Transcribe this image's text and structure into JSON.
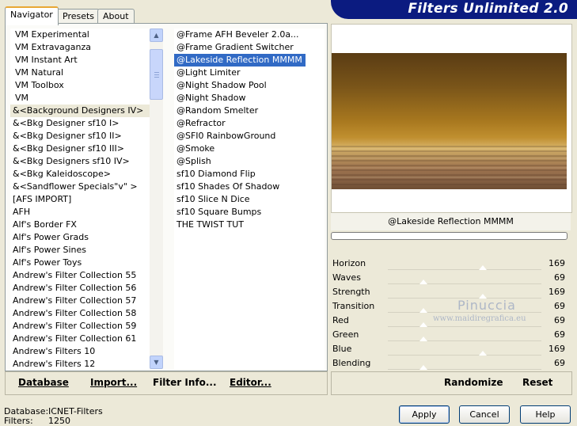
{
  "header": {
    "title": "Filters Unlimited 2.0"
  },
  "tabs": [
    {
      "label": "Navigator",
      "active": true
    },
    {
      "label": "Presets",
      "active": false
    },
    {
      "label": "About",
      "active": false
    }
  ],
  "categories": {
    "items": [
      "VM Experimental",
      "VM Extravaganza",
      "VM Instant Art",
      "VM Natural",
      "VM Toolbox",
      "VM",
      "&<Background Designers IV>",
      "&<Bkg Designer sf10 I>",
      "&<Bkg Designer sf10 II>",
      "&<Bkg Designer sf10 III>",
      "&<Bkg Designers sf10 IV>",
      "&<Bkg Kaleidoscope>",
      "&<Sandflower Specials\"v\" >",
      "[AFS IMPORT]",
      "AFH",
      "Alf's Border FX",
      "Alf's Power Grads",
      "Alf's Power Sines",
      "Alf's Power Toys",
      "Andrew's Filter Collection 55",
      "Andrew's Filter Collection 56",
      "Andrew's Filter Collection 57",
      "Andrew's Filter Collection 58",
      "Andrew's Filter Collection 59",
      "Andrew's Filter Collection 61",
      "Andrew's Filters 10",
      "Andrew's Filters 12"
    ],
    "selected_index": 6
  },
  "filters": {
    "items": [
      "@Frame AFH Beveler 2.0a...",
      "@Frame Gradient Switcher",
      "@Lakeside Reflection MMMM",
      "@Light Limiter",
      "@Night Shadow Pool",
      "@Night Shadow",
      "@Random Smelter",
      "@Refractor",
      "@SFI0 RainbowGround",
      "@Smoke",
      "@Splish",
      "sf10 Diamond Flip",
      "sf10 Shades Of Shadow",
      "sf10 Slice N Dice",
      "sf10 Square Bumps",
      "THE TWIST TUT"
    ],
    "selected_index": 2
  },
  "left_bar": {
    "database": "Database",
    "import": "Import...",
    "filter_info": "Filter Info...",
    "editor": "Editor..."
  },
  "preview": {
    "filter_name": "@Lakeside Reflection MMMM"
  },
  "params": [
    {
      "label": "Horizon",
      "value": "169"
    },
    {
      "label": "Waves",
      "value": "69"
    },
    {
      "label": "Strength",
      "value": "169"
    },
    {
      "label": "Transition",
      "value": "69"
    },
    {
      "label": "Red",
      "value": "69"
    },
    {
      "label": "Green",
      "value": "69"
    },
    {
      "label": "Blue",
      "value": "169"
    },
    {
      "label": "Blending",
      "value": "69"
    }
  ],
  "right_bar": {
    "randomize": "Randomize",
    "reset": "Reset"
  },
  "watermark": {
    "name": "Pinuccia",
    "site": "www.maidiregrafica.eu"
  },
  "footer": {
    "database_label": "Database:",
    "database_value": "ICNET-Filters",
    "filters_label": "Filters:",
    "filters_value": "1250"
  },
  "buttons": {
    "apply": "Apply",
    "cancel": "Cancel",
    "help": "Help"
  },
  "colors": {
    "banner": "#0b1b80",
    "selection": "#316ac5",
    "preview_top": "#5a3c14",
    "preview_gold": "#b8862a"
  }
}
